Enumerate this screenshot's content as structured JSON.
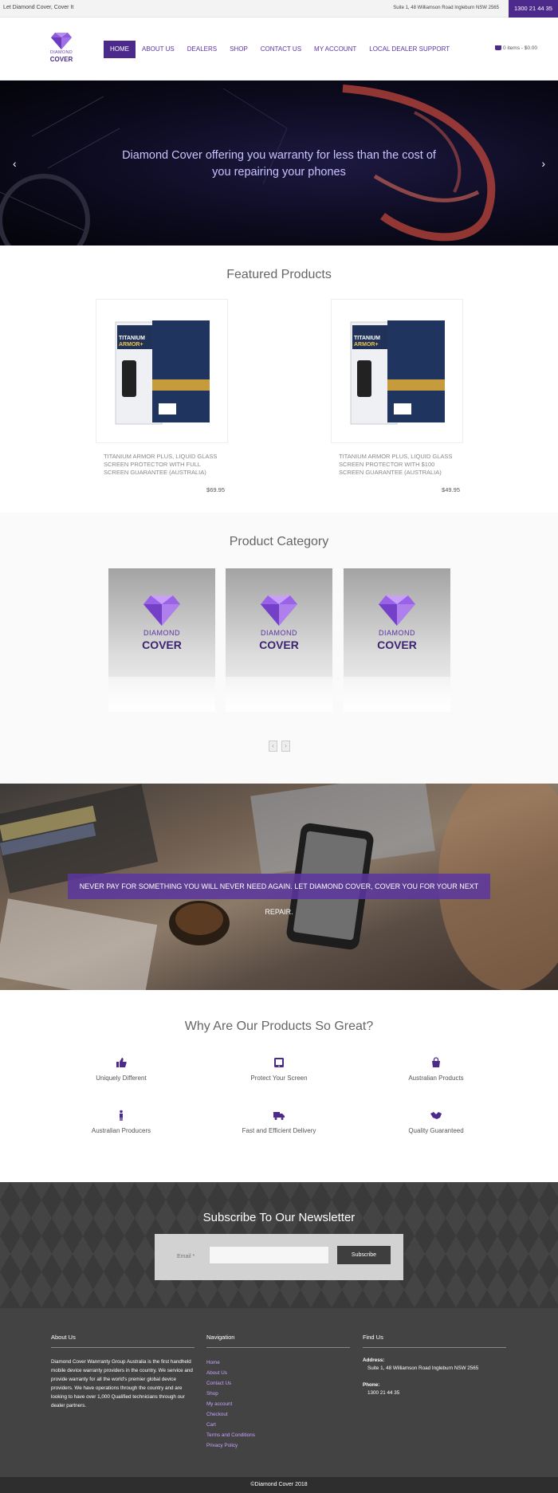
{
  "topbar": {
    "tagline": "Let Diamond Cover, Cover It",
    "address": "Suite 1, 48 Williamson Road Ingleburn NSW 2565",
    "phone": "1300 21 44 35"
  },
  "header": {
    "logo_line1": "DIAMOND",
    "logo_line2": "COVER",
    "nav": [
      {
        "label": "HOME",
        "active": true
      },
      {
        "label": "ABOUT US"
      },
      {
        "label": "DEALERS"
      },
      {
        "label": "SHOP"
      },
      {
        "label": "CONTACT US"
      },
      {
        "label": "MY ACCOUNT"
      },
      {
        "label": "LOCAL DEALER SUPPORT"
      }
    ],
    "cart": "0 items - $0.00"
  },
  "hero": {
    "caption": "Diamond Cover offering you warranty for less than the cost of you repairing your phones",
    "prev": "‹",
    "next": "›"
  },
  "featured": {
    "title": "Featured Products",
    "products": [
      {
        "name": "TITANIUM ARMOR PLUS, LIQUID GLASS SCREEN PROTECTOR WITH FULL SCREEN GUARANTEE (AUSTRALIA)",
        "price": "$69.95",
        "pack_title": "TITANIUM ARMOR+"
      },
      {
        "name": "TITANIUM ARMOR PLUS, LIQUID GLASS SCREEN PROTECTOR WITH $100 SCREEN GUARANTEE (AUSTRALIA)",
        "price": "$49.95",
        "pack_title": "TITANIUM ARMOR+"
      }
    ]
  },
  "category": {
    "title": "Product Category",
    "cards": [
      {
        "line1": "DIAMOND",
        "line2": "COVER"
      },
      {
        "line1": "DIAMOND",
        "line2": "COVER"
      },
      {
        "line1": "DIAMOND",
        "line2": "COVER"
      }
    ],
    "prev": "‹",
    "next": "›"
  },
  "banner": {
    "text": "NEVER PAY FOR SOMETHING YOU WILL NEVER NEED AGAIN. LET DIAMOND COVER, COVER YOU FOR YOUR NEXT REPAIR."
  },
  "why": {
    "title": "Why Are Our Products So Great?",
    "items": [
      {
        "label": "Uniquely Different",
        "icon": "thumbs-up-icon"
      },
      {
        "label": "Protect Your Screen",
        "icon": "tablet-icon"
      },
      {
        "label": "Australian Products",
        "icon": "shopping-bag-icon"
      },
      {
        "label": "Australian Producers",
        "icon": "person-icon"
      },
      {
        "label": "Fast and Efficient Delivery",
        "icon": "truck-icon"
      },
      {
        "label": "Quality Guaranteed",
        "icon": "handshake-icon"
      }
    ]
  },
  "newsletter": {
    "title": "Subscribe To Our Newsletter",
    "email_label": "Email *",
    "email_value": "",
    "button": "Subscribe"
  },
  "footer": {
    "about_title": "About Us",
    "about_text": "Diamond Cover Wanrranty Group Australia is the first handheld mobile device warranty providers in the country. We service and provide warranty for all the world's premier global device providers. We have operations through the country and are looking to have over 1,000 Qualified technicians through our dealer partners.",
    "nav_title": "Navigation",
    "nav_links": [
      "Home",
      "About Us",
      "Contact Us",
      "Shop",
      "My account",
      "Checkout",
      "Cart",
      "Terms and Conditions",
      "Privacy Policy"
    ],
    "find_title": "Find Us",
    "address_label": "Address:",
    "address_value": "Suite 1, 48 Williamson Road Ingleburn NSW 2565",
    "phone_label": "Phone:",
    "phone_value": "1300 21 44 35",
    "copyright": "©Diamond Cover 2018"
  },
  "colors": {
    "brand_purple": "#4b2a8b",
    "link_purple": "#c8a2ff",
    "footer_bg": "#434343"
  }
}
